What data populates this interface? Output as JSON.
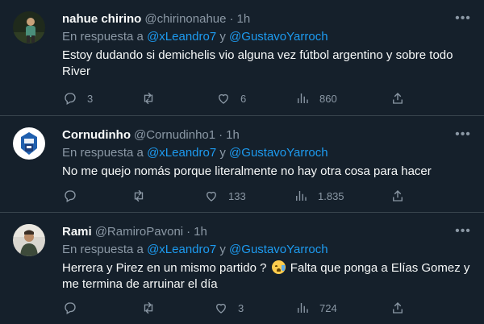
{
  "tweets": [
    {
      "name": "nahue chirino",
      "handle": "@chirinonahue",
      "time": "1h",
      "reply_prefix": "En respuesta a",
      "mention1": "@xLeandro7",
      "reply_join": "y",
      "mention2": "@GustavoYarroch",
      "text": "Estoy dudando si demichelis vio alguna vez fútbol argentino y sobre todo River",
      "replies": "3",
      "retweets": "",
      "likes": "6",
      "views": "860"
    },
    {
      "name": "Cornudinho",
      "handle": "@Cornudinho1",
      "time": "1h",
      "reply_prefix": "En respuesta a",
      "mention1": "@xLeandro7",
      "reply_join": "y",
      "mention2": "@GustavoYarroch",
      "text": "No me quejo nomás porque literalmente no hay otra cosa para hacer",
      "replies": "",
      "retweets": "",
      "likes": "133",
      "views": "1.835"
    },
    {
      "name": "Rami",
      "handle": "@RamiroPavoni",
      "time": "1h",
      "reply_prefix": "En respuesta a",
      "mention1": "@xLeandro7",
      "reply_join": "y",
      "mention2": "@GustavoYarroch",
      "text_before_emoji": "Herrera y Pirez en un mismo partido ?",
      "emoji_name": "crying-face",
      "text_after_emoji": "Falta que ponga a Elías Gomez y me termina de arruinar el día",
      "replies": "",
      "retweets": "",
      "likes": "3",
      "views": "724"
    }
  ],
  "icons": {
    "more": "more-horizontal-icon",
    "reply": "reply-bubble-icon",
    "retweet": "retweet-icon",
    "like": "heart-icon",
    "views": "views-bar-chart-icon",
    "share": "share-upload-icon"
  },
  "colors": {
    "background": "#15202b",
    "text": "#f7f9f9",
    "muted": "#8b98a5",
    "link": "#1d9bf0",
    "divider": "#38444d"
  }
}
